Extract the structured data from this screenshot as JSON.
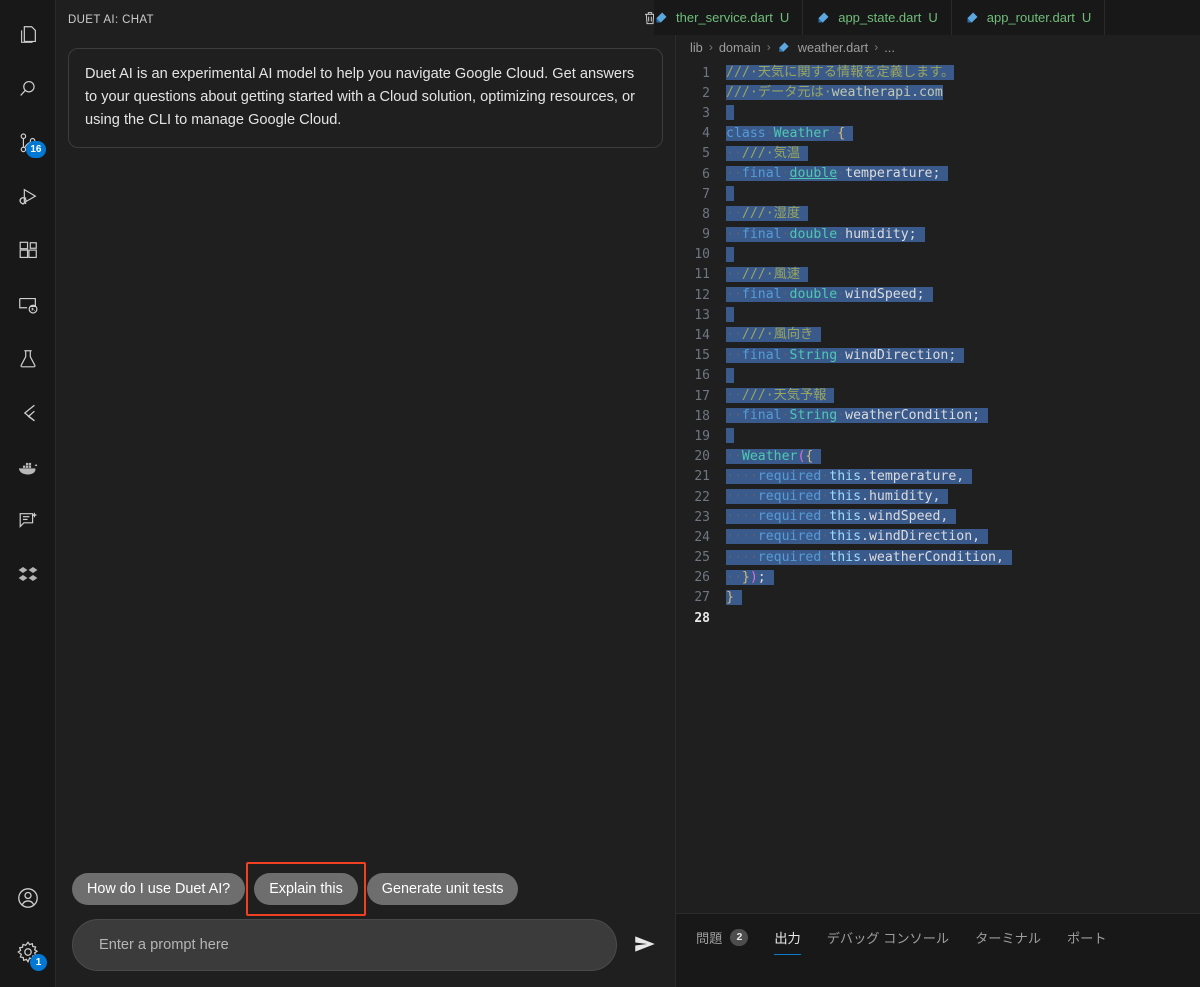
{
  "activitybar": {
    "items": [
      {
        "name": "explorer",
        "icon": "files-icon",
        "badge": null
      },
      {
        "name": "search",
        "icon": "search-icon",
        "badge": null
      },
      {
        "name": "source-control",
        "icon": "source-control-icon",
        "badge": "16"
      },
      {
        "name": "run-and-debug",
        "icon": "run-debug-icon",
        "badge": null
      },
      {
        "name": "extensions",
        "icon": "extensions-icon",
        "badge": null
      },
      {
        "name": "remote-explorer",
        "icon": "remote-explorer-icon",
        "badge": null
      },
      {
        "name": "testing",
        "icon": "beaker-icon",
        "badge": null
      },
      {
        "name": "flutter",
        "icon": "flutter-icon",
        "badge": null
      },
      {
        "name": "docker",
        "icon": "docker-icon",
        "badge": null
      },
      {
        "name": "duet-ai-chat",
        "icon": "chat-sparkle-icon",
        "badge": null
      },
      {
        "name": "dropbox",
        "icon": "diamonds-icon",
        "badge": null
      }
    ],
    "bottom": [
      {
        "name": "accounts",
        "icon": "account-icon",
        "badge": null
      },
      {
        "name": "manage-settings",
        "icon": "gear-icon",
        "badge": "1"
      }
    ]
  },
  "chat": {
    "title": "DUET AI: CHAT",
    "clear_icon": "trash-icon",
    "message": "Duet AI is an experimental AI model to help you navigate Google Cloud. Get answers to your questions about getting started with a Cloud solution, optimizing resources, or using the CLI to manage Google Cloud.",
    "suggestions": [
      {
        "label": "How do I use Duet AI?",
        "highlighted": false
      },
      {
        "label": "Explain this",
        "highlighted": true
      },
      {
        "label": "Generate unit tests",
        "highlighted": false
      }
    ],
    "prompt_placeholder": "Enter a prompt here",
    "prompt_value": "",
    "send_icon": "send-icon"
  },
  "editor": {
    "tabs": [
      {
        "label": "ther_service.dart",
        "status": "U",
        "icon": "dart-icon",
        "clipped": true,
        "active": false
      },
      {
        "label": "app_state.dart",
        "status": "U",
        "icon": "dart-icon",
        "clipped": false,
        "active": false
      },
      {
        "label": "app_router.dart",
        "status": "U",
        "icon": "dart-icon",
        "clipped": false,
        "active": false
      }
    ],
    "breadcrumb": [
      "lib",
      "domain",
      "weather.dart",
      "..."
    ],
    "breadcrumb_file_icon": "dart-icon",
    "active_line": 28,
    "total_lines": 28,
    "code_action_icon": "lightbulb-icon",
    "lines": [
      {
        "n": 1,
        "text": "/// 天気に関する情報を定義します。"
      },
      {
        "n": 2,
        "text": "/// データ元は weatherapi.com"
      },
      {
        "n": 3,
        "text": ""
      },
      {
        "n": 4,
        "text": "class Weather {"
      },
      {
        "n": 5,
        "text": "  /// 気温"
      },
      {
        "n": 6,
        "text": "  final double temperature;"
      },
      {
        "n": 7,
        "text": ""
      },
      {
        "n": 8,
        "text": "  /// 湿度"
      },
      {
        "n": 9,
        "text": "  final double humidity;"
      },
      {
        "n": 10,
        "text": ""
      },
      {
        "n": 11,
        "text": "  /// 風速"
      },
      {
        "n": 12,
        "text": "  final double windSpeed;"
      },
      {
        "n": 13,
        "text": ""
      },
      {
        "n": 14,
        "text": "  /// 風向き"
      },
      {
        "n": 15,
        "text": "  final String windDirection;"
      },
      {
        "n": 16,
        "text": ""
      },
      {
        "n": 17,
        "text": "  /// 天気予報"
      },
      {
        "n": 18,
        "text": "  final String weatherCondition;"
      },
      {
        "n": 19,
        "text": ""
      },
      {
        "n": 20,
        "text": "  Weather({"
      },
      {
        "n": 21,
        "text": "    required this.temperature,"
      },
      {
        "n": 22,
        "text": "    required this.humidity,"
      },
      {
        "n": 23,
        "text": "    required this.windSpeed,"
      },
      {
        "n": 24,
        "text": "    required this.windDirection,"
      },
      {
        "n": 25,
        "text": "    required this.weatherCondition,"
      },
      {
        "n": 26,
        "text": "  });"
      },
      {
        "n": 27,
        "text": "}"
      },
      {
        "n": 28,
        "text": ""
      }
    ]
  },
  "panel": {
    "tabs": [
      {
        "label": "問題",
        "count": "2",
        "active": false
      },
      {
        "label": "出力",
        "count": null,
        "active": true
      },
      {
        "label": "デバッグ コンソール",
        "count": null,
        "active": false
      },
      {
        "label": "ターミナル",
        "count": null,
        "active": false
      },
      {
        "label": "ポート",
        "count": null,
        "active": false
      }
    ]
  },
  "colors": {
    "accent": "#0078d4",
    "annotation": "#f03f21",
    "selection": "#3a5a8c",
    "tab_text": "#6fbd7a",
    "panel_active_underline": "#0a7aca"
  }
}
